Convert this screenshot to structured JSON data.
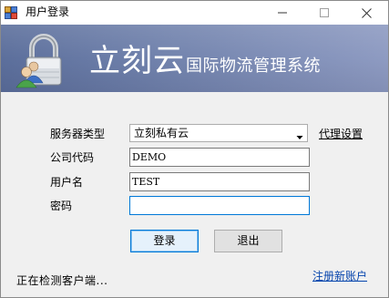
{
  "window": {
    "title": "用户登录"
  },
  "banner": {
    "brand_name": "立刻云",
    "subtitle": "国际物流管理系统"
  },
  "form": {
    "server_type": {
      "label": "服务器类型",
      "value": "立刻私有云"
    },
    "proxy_link": "代理设置",
    "company_code": {
      "label": "公司代码",
      "value": "DEMO"
    },
    "username": {
      "label": "用户名",
      "value": "TEST"
    },
    "password": {
      "label": "密码",
      "value": ""
    }
  },
  "buttons": {
    "login": "登录",
    "logout": "退出"
  },
  "footer": {
    "status": "正在检测客户端...",
    "register_link": "注册新账户"
  },
  "colors": {
    "banner": "#6f80aa",
    "link": "#0645ad",
    "focus": "#0078d7"
  }
}
